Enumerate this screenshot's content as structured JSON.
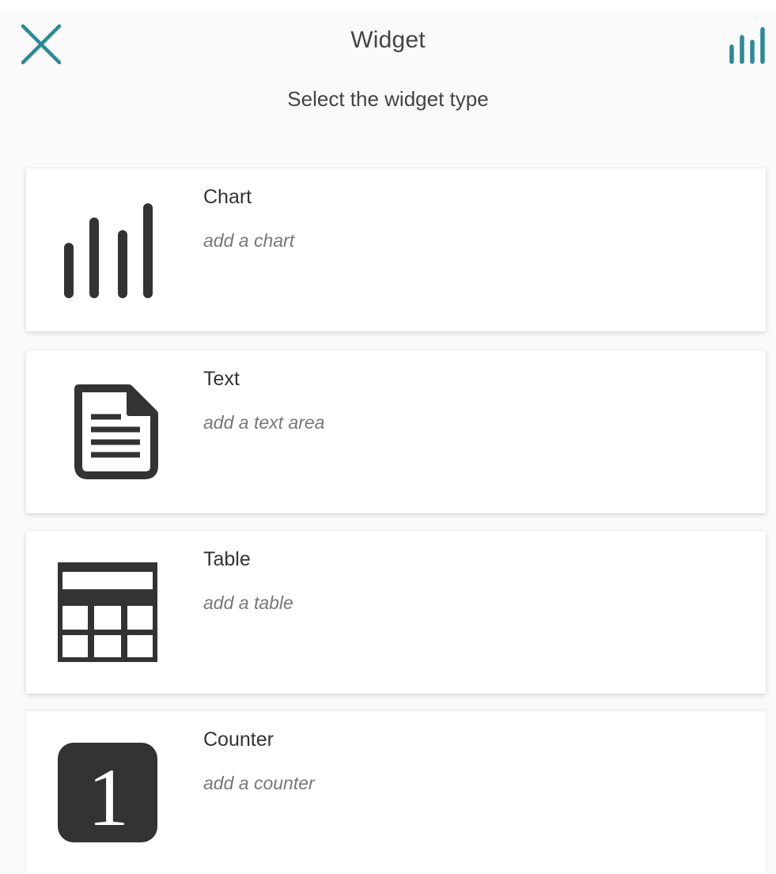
{
  "header": {
    "title": "Widget",
    "subtitle": "Select the widget type",
    "close_icon": "close-icon",
    "chart_icon": "bar-chart-icon",
    "accent_color": "#2a8a97"
  },
  "widgets": [
    {
      "title": "Chart",
      "description": "add a chart",
      "icon": "bar-chart-icon"
    },
    {
      "title": "Text",
      "description": "add a text area",
      "icon": "document-icon"
    },
    {
      "title": "Table",
      "description": "add a table",
      "icon": "table-icon"
    },
    {
      "title": "Counter",
      "description": "add a counter",
      "icon": "counter-icon",
      "icon_text": "1"
    }
  ],
  "colors": {
    "icon_dark": "#333333",
    "card_bg": "#ffffff",
    "page_bg": "#fafafa"
  }
}
